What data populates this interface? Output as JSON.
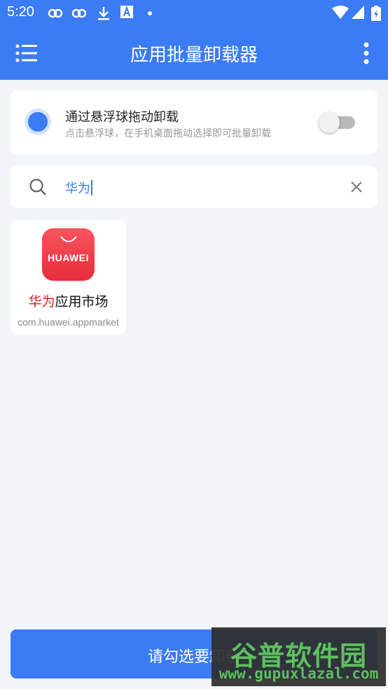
{
  "status_bar": {
    "time": "5:20",
    "icons": [
      "notification-icon",
      "notification-icon",
      "download-icon",
      "font-icon",
      "dot-icon",
      "wifi-icon",
      "signal-icon",
      "battery-icon"
    ]
  },
  "app_bar": {
    "title": "应用批量卸载器"
  },
  "floating": {
    "title": "通过悬浮球拖动卸载",
    "subtitle": "点击悬浮球，在手机桌面拖动选择即可批量卸载",
    "toggle_on": false
  },
  "search": {
    "query": "华为"
  },
  "apps": [
    {
      "icon_text": "HUAWEI",
      "name_highlight": "华为",
      "name_rest": "应用市场",
      "package": "com.huawei.appmarket"
    }
  ],
  "bottom_button": {
    "label": "请勾选要卸载"
  },
  "watermark": {
    "main": "谷普软件园",
    "url": "www.gupuxlazal.com"
  },
  "colors": {
    "primary": "#3b7bf3",
    "highlight": "#e21f1f",
    "background": "#f2f6f9"
  }
}
